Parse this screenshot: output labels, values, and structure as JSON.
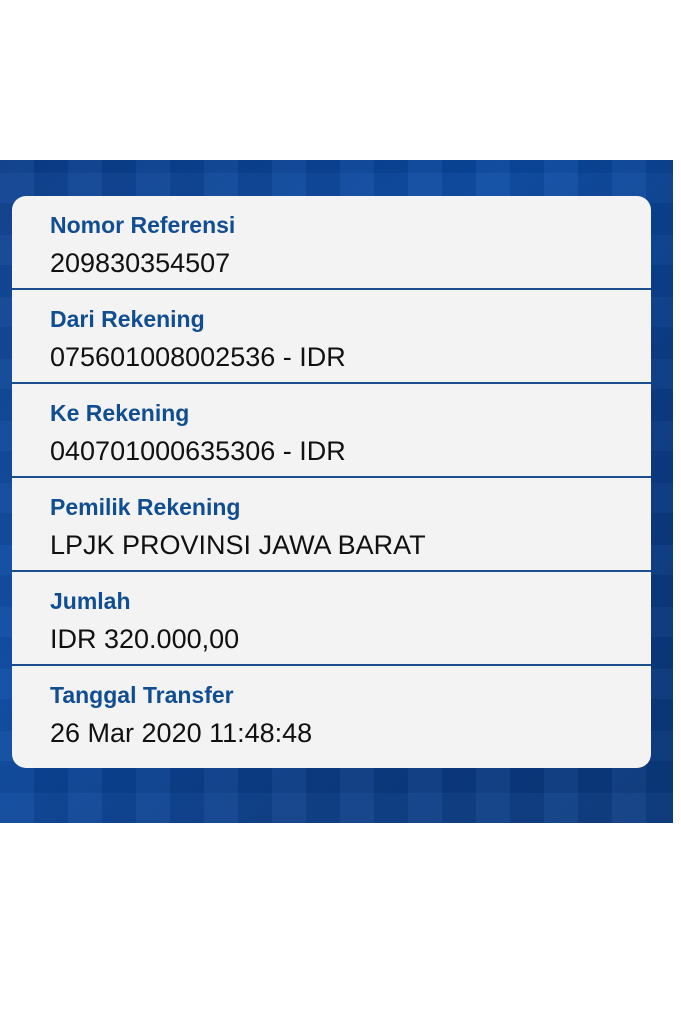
{
  "receipt": {
    "rows": [
      {
        "label": "Nomor Referensi",
        "value": "209830354507"
      },
      {
        "label": "Dari Rekening",
        "value": "075601008002536 - IDR"
      },
      {
        "label": "Ke Rekening",
        "value": "040701000635306 - IDR"
      },
      {
        "label": "Pemilik Rekening",
        "value": "LPJK PROVINSI JAWA BARAT"
      },
      {
        "label": "Jumlah",
        "value": "IDR 320.000,00"
      },
      {
        "label": "Tanggal Transfer",
        "value": "26 Mar 2020 11:48:48"
      }
    ]
  },
  "colors": {
    "label": "#114e91",
    "value": "#111111",
    "card": "#f3f3f3",
    "background": "#0b3f8e",
    "divider": "#1b4f8c"
  }
}
